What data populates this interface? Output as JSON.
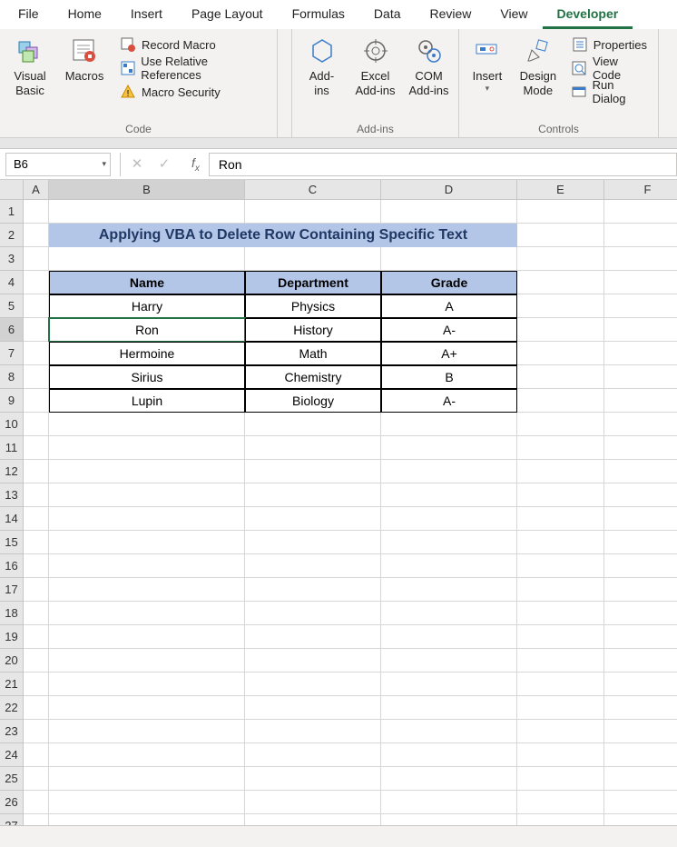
{
  "tabs": [
    "File",
    "Home",
    "Insert",
    "Page Layout",
    "Formulas",
    "Data",
    "Review",
    "View",
    "Developer"
  ],
  "activeTab": "Developer",
  "ribbon": {
    "code": {
      "visualBasic": "Visual\nBasic",
      "macros": "Macros",
      "recordMacro": "Record Macro",
      "useRelativeRefs": "Use Relative References",
      "macroSecurity": "Macro Security",
      "label": "Code"
    },
    "addins": {
      "addIns": "Add-\nins",
      "excelAddIns": "Excel\nAdd-ins",
      "comAddIns": "COM\nAdd-ins",
      "label": "Add-ins"
    },
    "controls": {
      "insert": "Insert",
      "designMode": "Design\nMode",
      "properties": "Properties",
      "viewCode": "View Code",
      "runDialog": "Run Dialog",
      "label": "Controls"
    }
  },
  "formulaBar": {
    "nameBox": "B6",
    "value": "Ron"
  },
  "columns": [
    "A",
    "B",
    "C",
    "D",
    "E",
    "F"
  ],
  "rowCount": 27,
  "selectedCell": "B6",
  "sheet": {
    "title": "Applying VBA to Delete Row Containing Specific Text",
    "headers": [
      "Name",
      "Department",
      "Grade"
    ],
    "rows": [
      [
        "Harry",
        "Physics",
        "A"
      ],
      [
        "Ron",
        "History",
        "A-"
      ],
      [
        "Hermoine",
        "Math",
        "A+"
      ],
      [
        "Sirius",
        "Chemistry",
        "B"
      ],
      [
        "Lupin",
        "Biology",
        "A-"
      ]
    ]
  }
}
